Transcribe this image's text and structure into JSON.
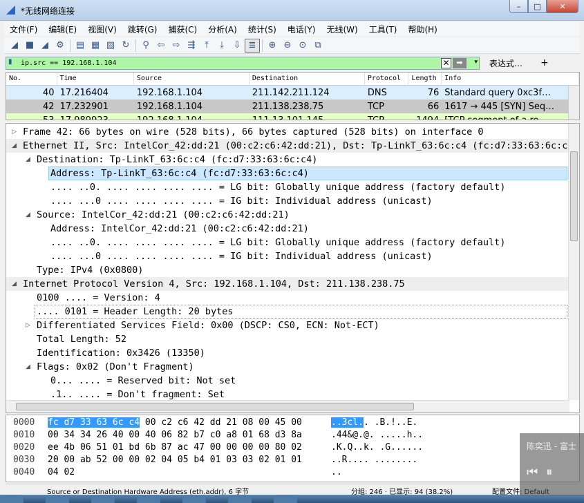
{
  "window": {
    "title": "*无线网络连接",
    "buttons": {
      "minimize": "–",
      "maximize": "□",
      "close": "✕"
    }
  },
  "menubar": [
    "文件(F)",
    "编辑(E)",
    "视图(V)",
    "跳转(G)",
    "捕获(C)",
    "分析(A)",
    "统计(S)",
    "电话(Y)",
    "无线(W)",
    "工具(T)",
    "帮助(H)"
  ],
  "toolbar": [
    {
      "icon": "shark-fin-start-icon",
      "glyph": "◢"
    },
    {
      "icon": "stop-icon",
      "glyph": "■"
    },
    {
      "icon": "restart-icon",
      "glyph": "◢"
    },
    {
      "icon": "options-gear-icon",
      "glyph": "⚙"
    },
    {
      "sep": true
    },
    {
      "icon": "open-file-icon",
      "glyph": "▤"
    },
    {
      "icon": "save-file-icon",
      "glyph": "▦"
    },
    {
      "icon": "close-file-icon",
      "glyph": "▧"
    },
    {
      "icon": "reload-icon",
      "glyph": "↻"
    },
    {
      "sep": true
    },
    {
      "icon": "find-icon",
      "glyph": "⚲"
    },
    {
      "icon": "go-back-icon",
      "glyph": "⇦"
    },
    {
      "icon": "go-forward-icon",
      "glyph": "⇨"
    },
    {
      "icon": "go-to-packet-icon",
      "glyph": "⇶"
    },
    {
      "icon": "first-packet-icon",
      "glyph": "⤒"
    },
    {
      "icon": "last-packet-icon",
      "glyph": "⤓"
    },
    {
      "icon": "autoscroll-icon",
      "glyph": "⇩"
    },
    {
      "icon": "colorize-icon",
      "glyph": "≣",
      "selected": true
    },
    {
      "sep": true
    },
    {
      "icon": "zoom-in-icon",
      "glyph": "⊕"
    },
    {
      "icon": "zoom-out-icon",
      "glyph": "⊖"
    },
    {
      "icon": "zoom-normal-icon",
      "glyph": "⊙"
    },
    {
      "icon": "resize-columns-icon",
      "glyph": "⧉"
    }
  ],
  "filter": {
    "value": "ip.src == 192.168.1.104",
    "expression_label": "表达式…",
    "plus": "+",
    "clear": "✕",
    "apply": "➡",
    "history": "▾"
  },
  "packet_list": {
    "columns": [
      "No.",
      "Time",
      "Source",
      "Destination",
      "Protocol",
      "Length",
      "Info"
    ],
    "rows": [
      {
        "no": "40",
        "time": "17.216404",
        "source": "192.168.1.104",
        "destination": "211.142.211.124",
        "protocol": "DNS",
        "length": "76",
        "info": "Standard query 0xc3f…",
        "bg": "#daeefd"
      },
      {
        "no": "42",
        "time": "17.232901",
        "source": "192.168.1.104",
        "destination": "211.138.238.75",
        "protocol": "TCP",
        "length": "66",
        "info": "1617 → 445 [SYN] Seq…",
        "bg": "#c8c8c8"
      },
      {
        "no": "53",
        "time": "17.989923",
        "source": "192.168.1.104",
        "destination": "111.13.101.145",
        "protocol": "TCP",
        "length": "1494",
        "info": "[TCP segment of a re…",
        "bg": "#e4ffc7"
      }
    ]
  },
  "details": [
    {
      "text": "Frame 42: 66 bytes on wire (528 bits), 66 bytes captured (528 bits) on interface 0",
      "indent": 0,
      "arrow": "collapsed"
    },
    {
      "text": "Ethernet II, Src: IntelCor_42:dd:21 (00:c2:c6:42:dd:21), Dst: Tp-LinkT_63:6c:c4 (fc:d7:33:63:6c:c4)",
      "indent": 0,
      "arrow": "expanded",
      "shade": true
    },
    {
      "text": "Destination: Tp-LinkT_63:6c:c4 (fc:d7:33:63:6c:c4)",
      "indent": 1,
      "arrow": "expanded"
    },
    {
      "text": "Address: Tp-LinkT_63:6c:c4 (fc:d7:33:63:6c:c4)",
      "indent": 2,
      "selected": true
    },
    {
      "text": ".... ..0. .... .... .... .... = LG bit: Globally unique address (factory default)",
      "indent": 2
    },
    {
      "text": ".... ...0 .... .... .... .... = IG bit: Individual address (unicast)",
      "indent": 2
    },
    {
      "text": "Source: IntelCor_42:dd:21 (00:c2:c6:42:dd:21)",
      "indent": 1,
      "arrow": "expanded"
    },
    {
      "text": "Address: IntelCor_42:dd:21 (00:c2:c6:42:dd:21)",
      "indent": 2
    },
    {
      "text": ".... ..0. .... .... .... .... = LG bit: Globally unique address (factory default)",
      "indent": 2
    },
    {
      "text": ".... ...0 .... .... .... .... = IG bit: Individual address (unicast)",
      "indent": 2
    },
    {
      "text": "Type: IPv4 (0x0800)",
      "indent": 1
    },
    {
      "text": "Internet Protocol Version 4, Src: 192.168.1.104, Dst: 211.138.238.75",
      "indent": 0,
      "arrow": "expanded",
      "shade": true
    },
    {
      "text": "0100 .... = Version: 4",
      "indent": 1
    },
    {
      "text": ".... 0101 = Header Length: 20 bytes",
      "indent": 1,
      "outlined": true
    },
    {
      "text": "Differentiated Services Field: 0x00 (DSCP: CS0, ECN: Not-ECT)",
      "indent": 1,
      "arrow": "collapsed"
    },
    {
      "text": "Total Length: 52",
      "indent": 1
    },
    {
      "text": "Identification: 0x3426 (13350)",
      "indent": 1
    },
    {
      "text": "Flags: 0x02 (Don't Fragment)",
      "indent": 1,
      "arrow": "expanded"
    },
    {
      "text": "0... .... = Reserved bit: Not set",
      "indent": 2
    },
    {
      "text": ".1.. .... = Don't fragment: Set",
      "indent": 2
    }
  ],
  "bytes": [
    {
      "offset": "0000",
      "hl_hex": "fc d7 33 63 6c c4",
      "hex": " 00 c2  c6 42 dd 21 08 00 45 00",
      "hl_ascii": "..3cl.",
      "ascii": ". .B.!..E."
    },
    {
      "offset": "0010",
      "hl_hex": "",
      "hex": "00 34 34 26 40 00 40 06  82 b7 c0 a8 01 68 d3 8a",
      "hl_ascii": "",
      "ascii": ".44&@.@. .....h.."
    },
    {
      "offset": "0020",
      "hl_hex": "",
      "hex": "ee 4b 06 51 01 bd 6b 87  ac 47 00 00 00 00 80 02",
      "hl_ascii": "",
      "ascii": ".K.Q..k. .G......"
    },
    {
      "offset": "0030",
      "hl_hex": "",
      "hex": "20 00 ab 52 00 00 02 04  05 b4 01 03 03 02 01 01",
      "hl_ascii": "",
      "ascii": " ..R.... ........"
    },
    {
      "offset": "0040",
      "hl_hex": "",
      "hex": "04 02",
      "hl_ascii": "",
      "ascii": ".."
    }
  ],
  "status": {
    "left": "Source or Destination Hardware Address (eth.addr), 6 字节",
    "middle": "分组: 246 · 已显示: 94 (38.2%)",
    "right": "配置文件: Default"
  },
  "notification": {
    "title": "陈奕迅 - 富士"
  }
}
